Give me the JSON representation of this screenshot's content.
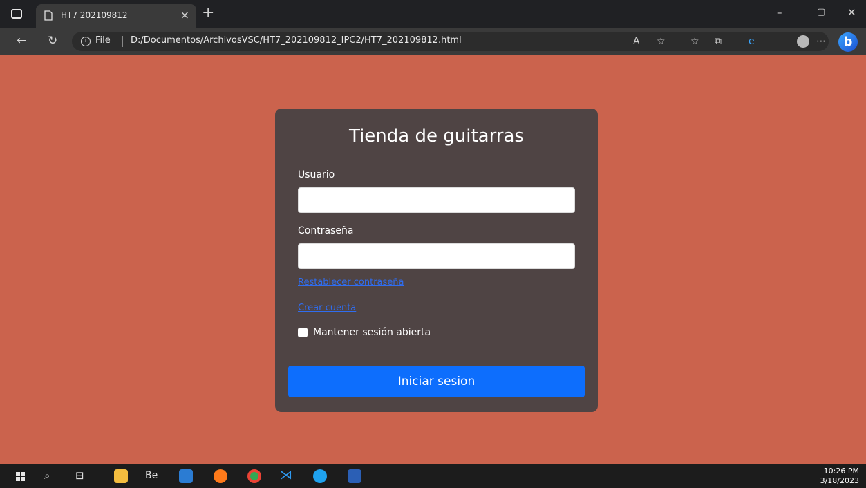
{
  "browser": {
    "tab_title": "HT7 202109812",
    "tab_close": "×",
    "new_tab": "+",
    "url_scheme": "File",
    "url": "D:/Documentos/ArchivosVSC/HT7_202109812_IPC2/HT7_202109812.html"
  },
  "page": {
    "heading": "Tienda de guitarras",
    "username_label": "Usuario",
    "username_value": "",
    "password_label": "Contraseña",
    "password_value": "",
    "reset_link": "Restablecer contraseña",
    "create_link": "Crear cuenta",
    "remember_label": "Mantener sesión abierta",
    "remember_checked": false,
    "submit_label": "Iniciar sesion"
  },
  "taskbar": {
    "time": "10:26 PM",
    "date": "3/18/2023"
  },
  "colors": {
    "page_background": "#cb634d",
    "card_background": "#4f4444",
    "primary_button": "#0d6efd",
    "link": "#2f6df0"
  }
}
